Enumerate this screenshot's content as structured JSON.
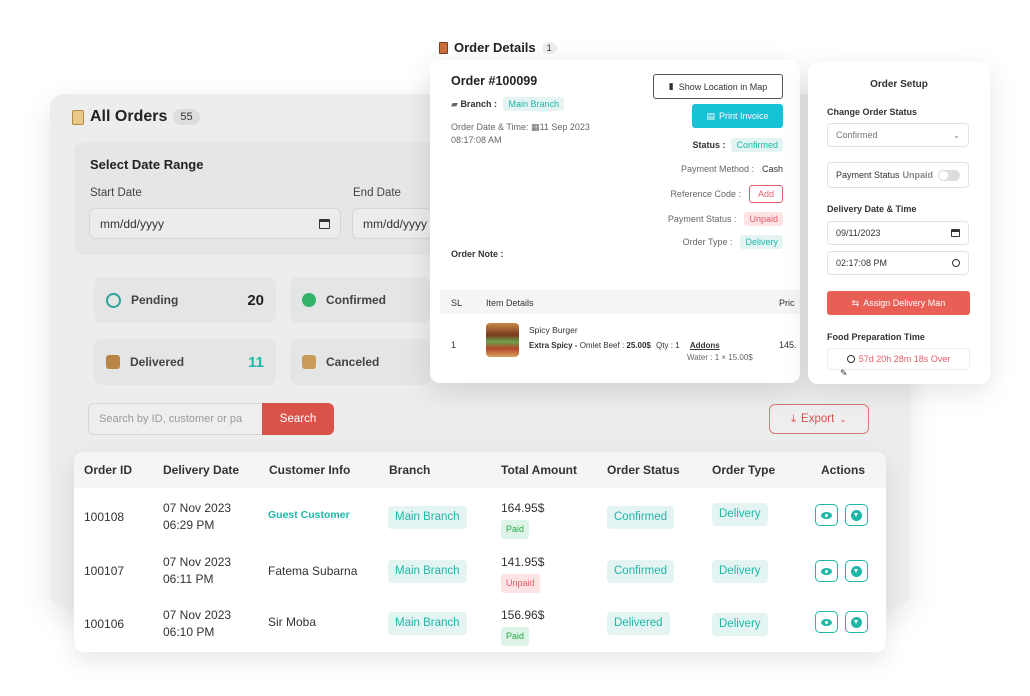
{
  "all_orders": {
    "title": "All Orders",
    "count": "55"
  },
  "date_range": {
    "title": "Select Date Range",
    "start_label": "Start Date",
    "end_label": "End Date",
    "start_placeholder": "mm/dd/yyyy",
    "end_placeholder": "mm/dd/yyyy"
  },
  "stats": {
    "pending_label": "Pending",
    "pending_count": "20",
    "confirmed_label": "Confirmed",
    "delivered_label": "Delivered",
    "delivered_count": "11",
    "canceled_label": "Canceled"
  },
  "search": {
    "placeholder": "Search by ID, customer or pa",
    "button": "Search"
  },
  "export": {
    "label": "Export"
  },
  "table": {
    "headers": [
      "Order ID",
      "Delivery Date",
      "Customer Info",
      "Branch",
      "Total Amount",
      "Order Status",
      "Order Type",
      "Actions"
    ],
    "rows": [
      {
        "id": "100108",
        "date": "07 Nov 2023",
        "time": "06:29 PM",
        "customer": "Guest Customer",
        "branch": "Main Branch",
        "amount": "164.95$",
        "payment": "Paid",
        "status": "Confirmed",
        "type": "Delivery"
      },
      {
        "id": "100107",
        "date": "07 Nov 2023",
        "time": "06:11 PM",
        "customer": "Fatema Subarna",
        "branch": "Main Branch",
        "amount": "141.95$",
        "payment": "Unpaid",
        "status": "Confirmed",
        "type": "Delivery"
      },
      {
        "id": "100106",
        "date": "07 Nov 2023",
        "time": "06:10 PM",
        "customer": "Sir Moba",
        "branch": "Main Branch",
        "amount": "156.96$",
        "payment": "Paid",
        "status": "Delivered",
        "type": "Delivery"
      }
    ]
  },
  "order_details": {
    "title": "Order Details",
    "count": "1",
    "order_number": "Order #100099",
    "branch_label": "Branch :",
    "branch_value": "Main Branch",
    "date_label": "Order Date & Time:",
    "date_value": "11 Sep 2023",
    "time_value": "08:17:08 AM",
    "show_location": "Show Location in Map",
    "print_invoice": "Print Invoice",
    "status_label": "Status :",
    "status_value": "Confirmed",
    "payment_method_label": "Payment Method :",
    "payment_method_value": "Cash",
    "reference_label": "Reference Code :",
    "reference_button": "Add",
    "payment_status_label": "Payment Status :",
    "payment_status_value": "Unpaid",
    "order_type_label": "Order Type :",
    "order_type_value": "Delivery",
    "order_note_label": "Order Note :",
    "items_headers": {
      "sl": "SL",
      "item": "Item Details",
      "price": "Pric"
    },
    "item": {
      "sl": "1",
      "name": "Spicy Burger",
      "variation": "Extra Spicy -",
      "option": "Omlet Beef :",
      "option_price": "25.00$",
      "qty": "Qty : 1",
      "addons_label": "Addons",
      "addon": "Water : 1 × 15.00$",
      "price": "145."
    }
  },
  "order_setup": {
    "title": "Order Setup",
    "change_status_label": "Change Order Status",
    "status_value": "Confirmed",
    "payment_status_label": "Payment Status",
    "payment_status_value": "Unpaid",
    "delivery_label": "Delivery Date & Time",
    "delivery_date": "09/11/2023",
    "delivery_time": "02:17:08 PM",
    "assign_button": "Assign Delivery Man",
    "prep_label": "Food Preparation Time",
    "prep_value": "57d 20h 28m 18s Over"
  },
  "colors": {
    "teal": "#1fb7a8",
    "red": "#d9534a",
    "cyan_button": "#17c1d6"
  }
}
